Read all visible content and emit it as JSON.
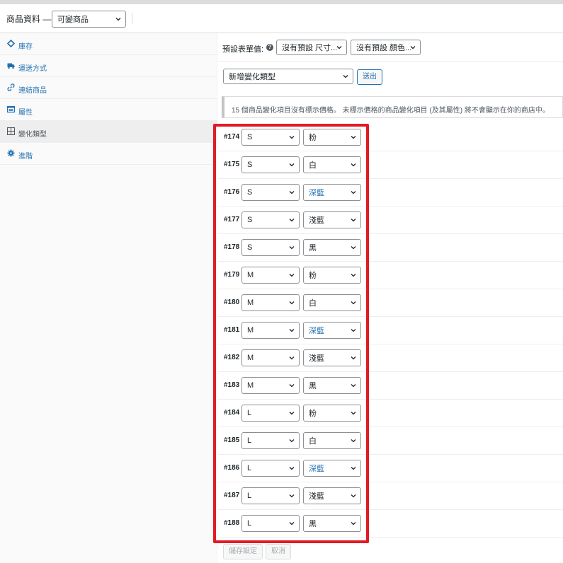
{
  "header": {
    "title": "商品資料 —",
    "product_type": "可變商品"
  },
  "sidebar": {
    "items": [
      {
        "label": "庫存",
        "icon": "diamond-icon",
        "active": false
      },
      {
        "label": "運送方式",
        "icon": "truck-icon",
        "active": false
      },
      {
        "label": "連結商品",
        "icon": "link-icon",
        "active": false
      },
      {
        "label": "屬性",
        "icon": "list-icon",
        "active": false
      },
      {
        "label": "變化類型",
        "icon": "grid-icon",
        "active": true
      },
      {
        "label": "進階",
        "icon": "gear-icon",
        "active": false
      }
    ]
  },
  "defaults": {
    "label": "預設表單值:",
    "select1": "沒有預設 尺寸...",
    "select2": "沒有預設 顏色..."
  },
  "add_variation": {
    "select": "新增變化類型",
    "go_button": "送出"
  },
  "notice": "15 個商品變化項目沒有標示價格。 未標示價格的商品變化項目 (及其屬性) 將不會顯示在你的商店中。",
  "variations": [
    {
      "id": "#174",
      "size": "S",
      "color": "粉"
    },
    {
      "id": "#175",
      "size": "S",
      "color": "白"
    },
    {
      "id": "#176",
      "size": "S",
      "color": "深藍"
    },
    {
      "id": "#177",
      "size": "S",
      "color": "淺藍"
    },
    {
      "id": "#178",
      "size": "S",
      "color": "黑"
    },
    {
      "id": "#179",
      "size": "M",
      "color": "粉"
    },
    {
      "id": "#180",
      "size": "M",
      "color": "白"
    },
    {
      "id": "#181",
      "size": "M",
      "color": "深藍"
    },
    {
      "id": "#182",
      "size": "M",
      "color": "淺藍"
    },
    {
      "id": "#183",
      "size": "M",
      "color": "黑"
    },
    {
      "id": "#184",
      "size": "L",
      "color": "粉"
    },
    {
      "id": "#185",
      "size": "L",
      "color": "白"
    },
    {
      "id": "#186",
      "size": "L",
      "color": "深藍"
    },
    {
      "id": "#187",
      "size": "L",
      "color": "淺藍"
    },
    {
      "id": "#188",
      "size": "L",
      "color": "黑"
    }
  ],
  "footer": {
    "save": "儲存設定",
    "cancel": "取消"
  },
  "colors": {
    "link": "#2271b1",
    "highlight": "#e01b24"
  }
}
